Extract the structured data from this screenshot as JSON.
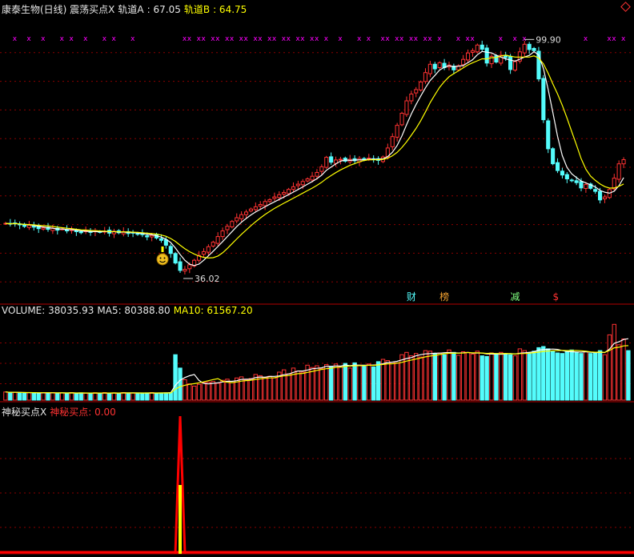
{
  "header": {
    "main_title": "康泰生物(日线) 震荡买点X",
    "rail_a_label": "轨道A",
    "rail_a_value": ": 67.05",
    "rail_b_label": "轨道B",
    "rail_b_value": ": 64.75"
  },
  "volume_header": {
    "label": "VOLUME: 38035.93",
    "ma5": "MA5: 80388.80",
    "ma10": "MA10: 61567.20"
  },
  "indicator_header": {
    "label": "神秘买点X",
    "value_label": "神秘买点: 0.00"
  },
  "annotations": {
    "high_label": "99.90",
    "low_label": "36.02",
    "markers": [
      "财",
      "榜",
      "减",
      "$"
    ]
  },
  "colors": {
    "up": "#ff3232",
    "down": "#54fcfc",
    "ma_a": "#ffffff",
    "ma_b": "#ffff00",
    "x_mark": "#ff00ff",
    "grid": "#8b0000"
  },
  "icons": [
    "smiley-icon",
    "diamond-icon"
  ],
  "chart_data": {
    "type": "candlestick",
    "price_range": [
      30,
      106
    ],
    "volume_range": [
      0,
      140000
    ],
    "closes": [
      51,
      50.8,
      51,
      50.6,
      50.2,
      50.5,
      50,
      49.6,
      49.8,
      49.4,
      49.7,
      49.2,
      49.5,
      49,
      49.3,
      48.8,
      48.5,
      49,
      48.6,
      49.1,
      48.7,
      48.9,
      48.4,
      48.9,
      48.5,
      48.8,
      48.3,
      48.5,
      48.1,
      48,
      47.4,
      47.8,
      47.1,
      46.5,
      45.2,
      43,
      40.5,
      38.5,
      38.8,
      40,
      41.2,
      42.5,
      43.5,
      44.8,
      46,
      47.5,
      49,
      50.2,
      51.5,
      52.5,
      53.3,
      54,
      54.8,
      55.4,
      56,
      56.8,
      57.3,
      58,
      58.6,
      59.2,
      60,
      60.7,
      61.4,
      62.1,
      62.8,
      63.5,
      64.5,
      66,
      68.5,
      67.2,
      67.8,
      68,
      67.5,
      68,
      67.6,
      68.2,
      67.9,
      68.3,
      68,
      67.7,
      68.6,
      71,
      74,
      77,
      80.2,
      83.5,
      85.3,
      86.5,
      88.5,
      91,
      93.2,
      92,
      93.6,
      92.3,
      93,
      91.7,
      92.8,
      94.5,
      96.2,
      96.8,
      98.3,
      97.2,
      93.5,
      95.3,
      93.8,
      95.6,
      95,
      91.8,
      93.9,
      96.5,
      98.5,
      97.1,
      96.8,
      89.3,
      78.5,
      70.8,
      66.8,
      65,
      63.8,
      62.8,
      62.3,
      61.8,
      60.4,
      61.3,
      60.3,
      59.5,
      57.2,
      58,
      60,
      63,
      66.8,
      67.9
    ],
    "volumes": [
      14000,
      13000,
      13500,
      12500,
      12000,
      13000,
      12500,
      12000,
      12800,
      12200,
      13000,
      12000,
      12500,
      12000,
      13000,
      11800,
      12500,
      12000,
      11500,
      12800,
      12000,
      13000,
      11800,
      12500,
      12000,
      13000,
      12500,
      12200,
      11800,
      12000,
      12500,
      13000,
      12000,
      12300,
      12500,
      13000,
      78000,
      55000,
      35000,
      28000,
      24000,
      27000,
      30000,
      31000,
      32000,
      29000,
      34000,
      36000,
      30000,
      38000,
      40000,
      35000,
      37000,
      44000,
      42000,
      39000,
      41000,
      38000,
      48000,
      52000,
      45000,
      55000,
      50000,
      48000,
      60000,
      56000,
      59000,
      54000,
      61000,
      58000,
      62000,
      57000,
      63000,
      55000,
      64000,
      60000,
      58000,
      62000,
      57000,
      66000,
      70000,
      68000,
      65000,
      64000,
      78000,
      82000,
      76000,
      80000,
      74000,
      85000,
      84000,
      79000,
      81000,
      78000,
      86000,
      82000,
      77000,
      83000,
      82000,
      79000,
      84000,
      76000,
      75000,
      81000,
      80000,
      82000,
      79000,
      78000,
      76000,
      88000,
      85000,
      82000,
      84000,
      90000,
      92000,
      88000,
      84000,
      81000,
      80000,
      84000,
      86000,
      82000,
      80000,
      83000,
      80000,
      82000,
      85000,
      78000,
      112000,
      130000,
      95000,
      105000,
      85000
    ],
    "ma5_line": "MA5",
    "ma10_line": "MA10",
    "signal_series": [
      0,
      0,
      0,
      0,
      0,
      0,
      0,
      0,
      0,
      0,
      0,
      0,
      0,
      0,
      0,
      0,
      0,
      0,
      0,
      0,
      0,
      0,
      0,
      0,
      0,
      0,
      0,
      0,
      0,
      0,
      0,
      0,
      0,
      0,
      0,
      0,
      0,
      100,
      0,
      0,
      0,
      0,
      0,
      0,
      0,
      0,
      0,
      0,
      0,
      0,
      0,
      0,
      0,
      0,
      0,
      0,
      0,
      0,
      0,
      0,
      0,
      0,
      0,
      0,
      0,
      0,
      0,
      0,
      0,
      0,
      0,
      0,
      0,
      0,
      0,
      0,
      0,
      0,
      0,
      0,
      0,
      0,
      0,
      0,
      0,
      0,
      0,
      0,
      0,
      0,
      0,
      0,
      0,
      0,
      0,
      0,
      0,
      0,
      0,
      0,
      0,
      0,
      0,
      0,
      0,
      0,
      0,
      0,
      0,
      0,
      0,
      0,
      0,
      0,
      0,
      0,
      0,
      0,
      0,
      0,
      0,
      0,
      0,
      0,
      0,
      0,
      0,
      0,
      0,
      0,
      0,
      0,
      0
    ],
    "signal_range": [
      0,
      100
    ]
  }
}
